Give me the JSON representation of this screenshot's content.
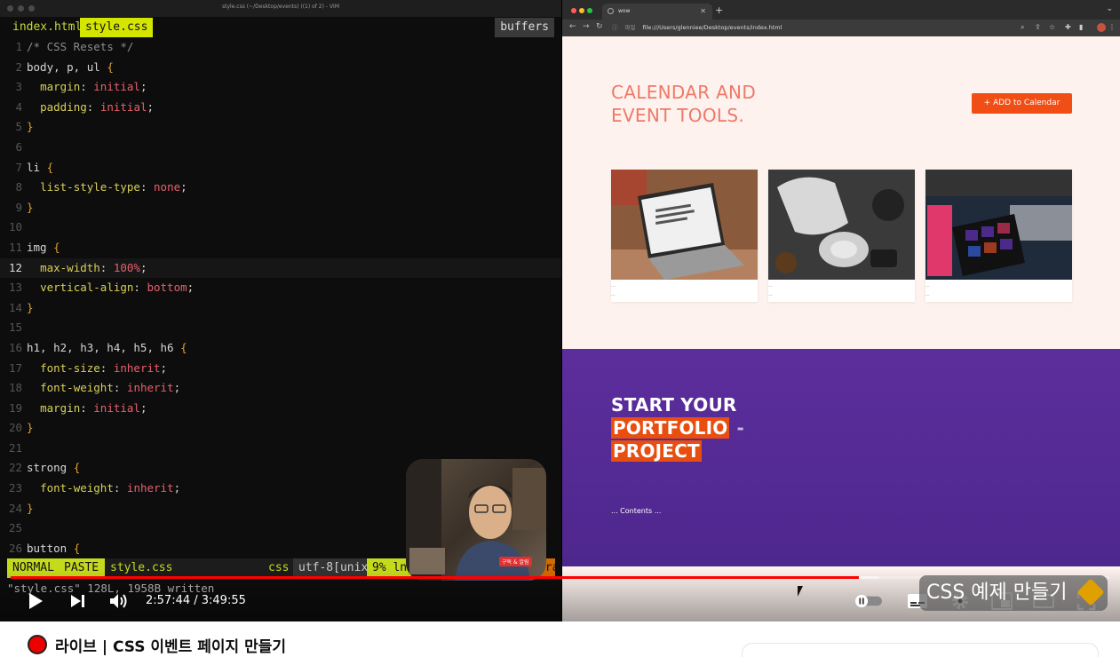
{
  "vim": {
    "window_title": "style.css (~/Desktop/events) ((1) of 2) - VIM",
    "tabs": [
      "index.html",
      "style.css"
    ],
    "active_tab": "style.css",
    "buffers_label": "buffers",
    "lines": [
      {
        "n": "1",
        "t": [
          [
            "cm",
            "/* CSS Resets */"
          ]
        ]
      },
      {
        "n": "2",
        "t": [
          [
            "",
            "body, p, ul "
          ],
          [
            "p",
            "{"
          ]
        ]
      },
      {
        "n": "3",
        "t": [
          [
            "",
            "  "
          ],
          [
            "prop",
            "margin"
          ],
          [
            "",
            ": "
          ],
          [
            "val",
            "initial"
          ],
          [
            "",
            ";"
          ]
        ]
      },
      {
        "n": "4",
        "t": [
          [
            "",
            "  "
          ],
          [
            "prop",
            "padding"
          ],
          [
            "",
            ": "
          ],
          [
            "val",
            "initial"
          ],
          [
            "",
            ";"
          ]
        ]
      },
      {
        "n": "5",
        "t": [
          [
            "p",
            "}"
          ]
        ]
      },
      {
        "n": "6",
        "t": []
      },
      {
        "n": "7",
        "t": [
          [
            "",
            "li "
          ],
          [
            "p",
            "{"
          ]
        ]
      },
      {
        "n": "8",
        "t": [
          [
            "",
            "  "
          ],
          [
            "prop",
            "list-style-type"
          ],
          [
            "",
            ": "
          ],
          [
            "val",
            "none"
          ],
          [
            "",
            ";"
          ]
        ]
      },
      {
        "n": "9",
        "t": [
          [
            "p",
            "}"
          ]
        ]
      },
      {
        "n": "10",
        "t": []
      },
      {
        "n": "11",
        "t": [
          [
            "",
            "img "
          ],
          [
            "p",
            "{"
          ]
        ]
      },
      {
        "n": "12",
        "t": [
          [
            "",
            "  "
          ],
          [
            "prop",
            "max-width"
          ],
          [
            "",
            ": "
          ],
          [
            "val",
            "100%"
          ],
          [
            "",
            ";"
          ]
        ],
        "current": true
      },
      {
        "n": "13",
        "t": [
          [
            "",
            "  "
          ],
          [
            "prop",
            "vertical-align"
          ],
          [
            "",
            ": "
          ],
          [
            "val",
            "bottom"
          ],
          [
            "",
            ";"
          ]
        ]
      },
      {
        "n": "14",
        "t": [
          [
            "p",
            "}"
          ]
        ]
      },
      {
        "n": "15",
        "t": []
      },
      {
        "n": "16",
        "t": [
          [
            "",
            "h1, h2, h3, h4, h5, h6 "
          ],
          [
            "p",
            "{"
          ]
        ]
      },
      {
        "n": "17",
        "t": [
          [
            "",
            "  "
          ],
          [
            "prop",
            "font-size"
          ],
          [
            "",
            ": "
          ],
          [
            "val",
            "inherit"
          ],
          [
            "",
            ";"
          ]
        ]
      },
      {
        "n": "18",
        "t": [
          [
            "",
            "  "
          ],
          [
            "prop",
            "font-weight"
          ],
          [
            "",
            ": "
          ],
          [
            "val",
            "inherit"
          ],
          [
            "",
            ";"
          ]
        ]
      },
      {
        "n": "19",
        "t": [
          [
            "",
            "  "
          ],
          [
            "prop",
            "margin"
          ],
          [
            "",
            ": "
          ],
          [
            "val",
            "initial"
          ],
          [
            "",
            ";"
          ]
        ]
      },
      {
        "n": "20",
        "t": [
          [
            "p",
            "}"
          ]
        ]
      },
      {
        "n": "21",
        "t": []
      },
      {
        "n": "22",
        "t": [
          [
            "",
            "strong "
          ],
          [
            "p",
            "{"
          ]
        ]
      },
      {
        "n": "23",
        "t": [
          [
            "",
            "  "
          ],
          [
            "prop",
            "font-weight"
          ],
          [
            "",
            ": "
          ],
          [
            "val",
            "inherit"
          ],
          [
            "",
            ";"
          ]
        ]
      },
      {
        "n": "24",
        "t": [
          [
            "p",
            "}"
          ]
        ]
      },
      {
        "n": "25",
        "t": []
      },
      {
        "n": "26",
        "t": [
          [
            "",
            "button "
          ],
          [
            "p",
            "{"
          ]
        ]
      }
    ],
    "status": {
      "mode": "NORMAL",
      "paste": "PASTE",
      "file": "style.css",
      "filetype": "css",
      "encoding": "utf-8[unix]",
      "position": "9%  ln:12/128≡:18",
      "warning": "≡ [42]tra"
    },
    "message": "\"style.css\" 128L, 1958B written"
  },
  "browser": {
    "tab_title": "wow",
    "url_label": "파일",
    "url": "file:///Users/glenniee/Desktop/events/index.html",
    "hero_title_line1": "CALENDAR AND",
    "hero_title_line2": "EVENT TOOLS.",
    "add_button": "+ ADD to Calendar",
    "cards": [
      {
        "meta1": "...",
        "meta2": "..."
      },
      {
        "meta1": "...",
        "meta2": "..."
      },
      {
        "meta1": "...",
        "meta2": "..."
      }
    ],
    "portfolio_line1": "START YOUR",
    "portfolio_line2": "PORTFOLIO",
    "portfolio_dash": "-",
    "portfolio_line3": "PROJECT",
    "contents": "... Contents ...",
    "subscribe_badge": "구독 & 알림"
  },
  "player": {
    "time": "2:57:44 / 3:49:55",
    "progress": 0.772,
    "buffered_to": 0.79,
    "watermark": "CSS 예제 만들기"
  },
  "video": {
    "title": "라이브 | CSS 이벤트 페이지 만들기"
  }
}
